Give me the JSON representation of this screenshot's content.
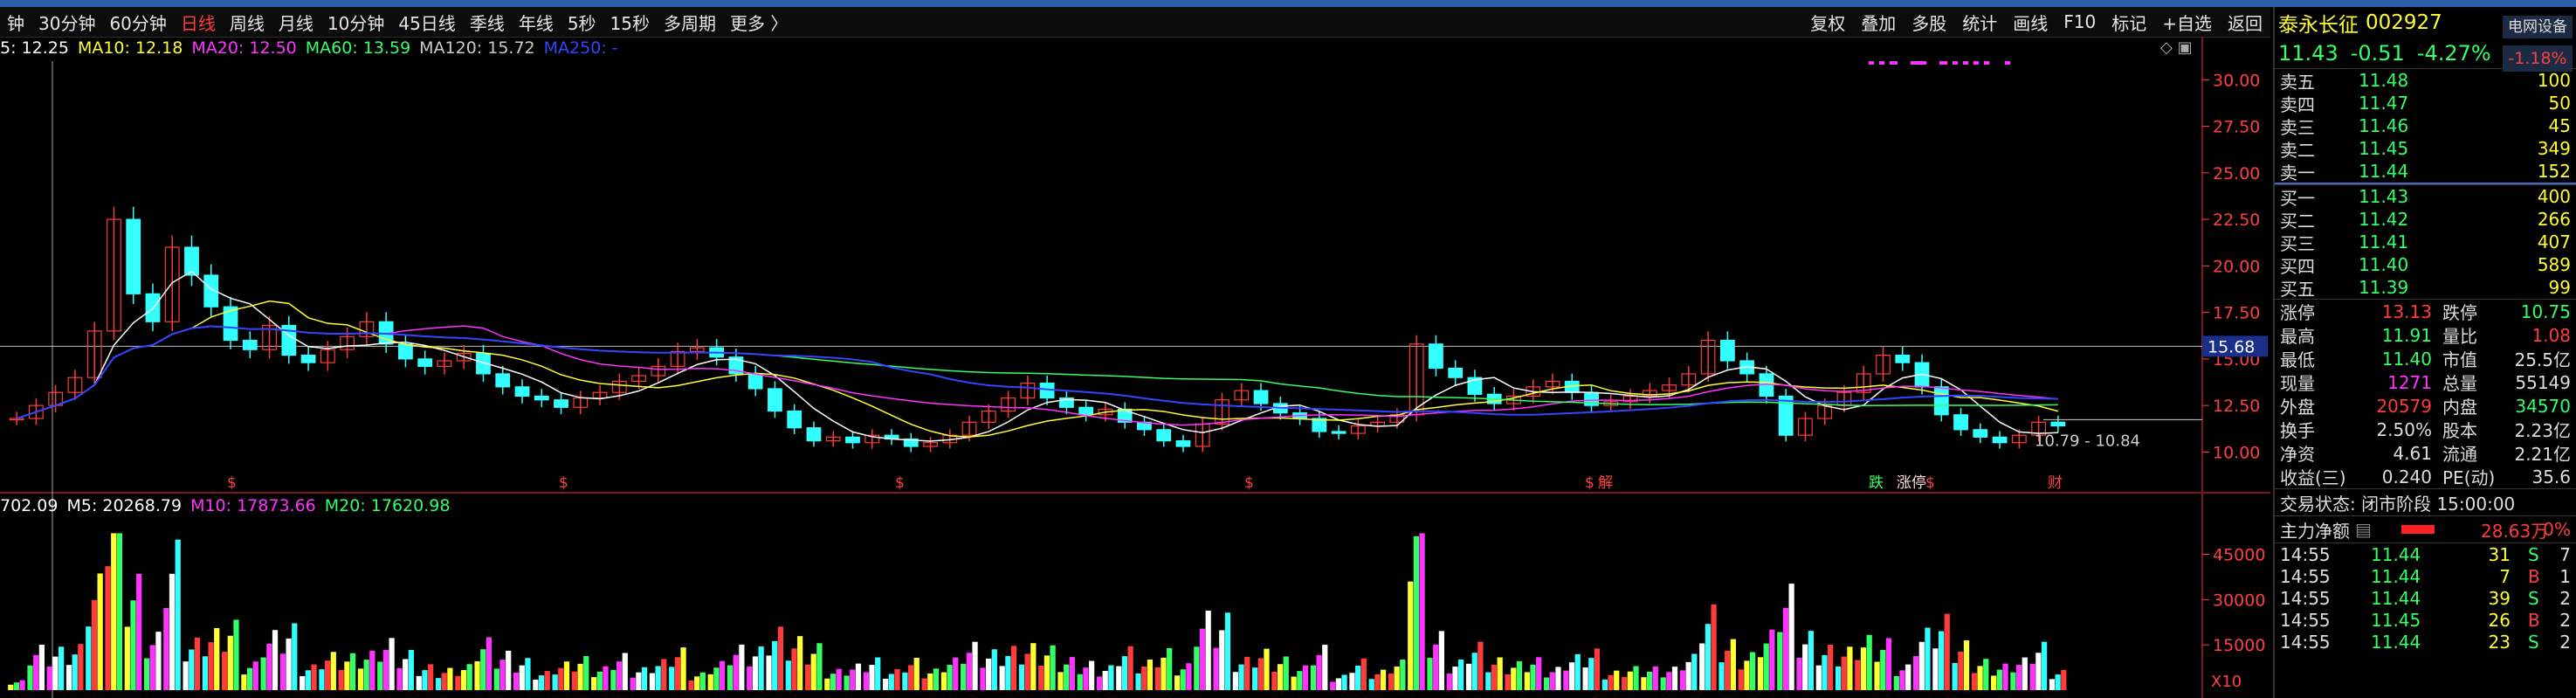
{
  "toolbar": {
    "periods": [
      {
        "label": "钟",
        "active": false
      },
      {
        "label": "30分钟",
        "active": false
      },
      {
        "label": "60分钟",
        "active": false
      },
      {
        "label": "日线",
        "active": true
      },
      {
        "label": "周线",
        "active": false
      },
      {
        "label": "月线",
        "active": false
      },
      {
        "label": "10分钟",
        "active": false
      },
      {
        "label": "45日线",
        "active": false
      },
      {
        "label": "季线",
        "active": false
      },
      {
        "label": "年线",
        "active": false
      },
      {
        "label": "5秒",
        "active": false
      },
      {
        "label": "15秒",
        "active": false
      },
      {
        "label": "多周期",
        "active": false
      },
      {
        "label": "更多 〉",
        "active": false
      }
    ],
    "tools": [
      "复权",
      "叠加",
      "多股",
      "统计",
      "画线",
      "F10",
      "标记",
      "+自选",
      "返回"
    ]
  },
  "ma_legend": [
    {
      "text": "5: 12.25",
      "color": "#ffffff"
    },
    {
      "text": "MA10: 12.18",
      "color": "#ffff33"
    },
    {
      "text": "MA20: 12.50",
      "color": "#ff33ff"
    },
    {
      "text": "MA60: 13.59",
      "color": "#33ff66"
    },
    {
      "text": "MA120: 15.72",
      "color": "#cccccc"
    },
    {
      "text": "MA250: -",
      "color": "#3344ff"
    }
  ],
  "vol_legend": [
    {
      "text": "702.09",
      "color": "#ffffff"
    },
    {
      "text": "M5: 20268.79",
      "color": "#ffffff"
    },
    {
      "text": "M10: 17873.66",
      "color": "#ff33ff"
    },
    {
      "text": "M20: 17620.98",
      "color": "#33ff66"
    }
  ],
  "chart_data": {
    "type": "candlestick",
    "price_axis": {
      "ticks": [
        "30.00",
        "27.50",
        "25.00",
        "22.50",
        "20.00",
        "17.50",
        "15.00",
        "12.50",
        "10.00"
      ],
      "ylim": [
        8,
        31
      ]
    },
    "volume_axis": {
      "ticks": [
        "45000",
        "30000",
        "15000"
      ],
      "unit_label": "X10",
      "ylim": [
        0,
        55000
      ]
    },
    "crosshair_price_label": "15.68",
    "range_annotation": "10.79 - 10.84",
    "event_markers": [
      "$",
      "$",
      "$",
      "$",
      "$",
      "解",
      "跌",
      "涨停",
      "$",
      "财"
    ],
    "close_series": [
      11.8,
      12.5,
      13.2,
      14.0,
      16.5,
      22.5,
      18.5,
      17.0,
      21.0,
      19.5,
      17.8,
      16.0,
      15.5,
      16.8,
      15.2,
      14.8,
      15.5,
      16.2,
      17.0,
      15.8,
      15.0,
      14.6,
      14.9,
      15.3,
      14.2,
      13.5,
      13.0,
      12.8,
      12.4,
      12.9,
      13.2,
      13.8,
      14.1,
      14.6,
      15.4,
      15.6,
      15.1,
      14.2,
      13.4,
      12.2,
      11.3,
      10.6,
      10.8,
      10.5,
      10.9,
      10.7,
      10.3,
      10.5,
      10.9,
      11.6,
      12.2,
      12.9,
      13.7,
      12.9,
      12.4,
      12.0,
      12.3,
      11.6,
      11.2,
      10.6,
      10.3,
      11.5,
      12.8,
      13.3,
      12.6,
      12.1,
      11.8,
      11.1,
      11.0,
      11.4,
      11.6,
      12.0,
      15.8,
      14.5,
      14.0,
      13.1,
      12.6,
      13.0,
      13.5,
      13.8,
      13.2,
      12.5,
      12.7,
      13.0,
      13.3,
      13.6,
      14.2,
      16.0,
      14.9,
      14.2,
      13.0,
      10.9,
      11.8,
      12.5,
      13.2,
      14.2,
      15.2,
      14.8,
      13.5,
      12.0,
      11.2,
      10.8,
      10.5,
      10.9,
      11.6,
      11.4
    ]
  },
  "quote": {
    "name": "泰永长征",
    "code": "002927",
    "btn_device": "电网设备",
    "sector_change": "-1.18%",
    "price": "11.43",
    "change": "-0.51",
    "change_pct": "-4.27%",
    "asks": [
      {
        "label": "卖五",
        "price": "11.48",
        "vol": "100"
      },
      {
        "label": "卖四",
        "price": "11.47",
        "vol": "50"
      },
      {
        "label": "卖三",
        "price": "11.46",
        "vol": "45"
      },
      {
        "label": "卖二",
        "price": "11.45",
        "vol": "349"
      },
      {
        "label": "卖一",
        "price": "11.44",
        "vol": "152"
      }
    ],
    "bids": [
      {
        "label": "买一",
        "price": "11.43",
        "vol": "400"
      },
      {
        "label": "买二",
        "price": "11.42",
        "vol": "266"
      },
      {
        "label": "买三",
        "price": "11.41",
        "vol": "407"
      },
      {
        "label": "买四",
        "price": "11.40",
        "vol": "589"
      },
      {
        "label": "买五",
        "price": "11.39",
        "vol": "99"
      }
    ],
    "stats": [
      {
        "l1": "涨停",
        "v1": "13.13",
        "c1": "red",
        "l2": "跌停",
        "v2": "10.75",
        "c2": "green"
      },
      {
        "l1": "最高",
        "v1": "11.91",
        "c1": "green",
        "l2": "量比",
        "v2": "1.08",
        "c2": "red"
      },
      {
        "l1": "最低",
        "v1": "11.40",
        "c1": "green",
        "l2": "市值",
        "v2": "25.5亿",
        "c2": "white"
      },
      {
        "l1": "现量",
        "v1": "1271",
        "c1": "mag",
        "l2": "总量",
        "v2": "55149",
        "c2": "white"
      },
      {
        "l1": "外盘",
        "v1": "20579",
        "c1": "red",
        "l2": "内盘",
        "v2": "34570",
        "c2": "green"
      },
      {
        "l1": "换手",
        "v1": "2.50%",
        "c1": "white",
        "l2": "股本",
        "v2": "2.23亿",
        "c2": "white"
      },
      {
        "l1": "净资",
        "v1": "4.61",
        "c1": "white",
        "l2": "流通",
        "v2": "2.21亿",
        "c2": "white"
      },
      {
        "l1": "收益(三)",
        "v1": "0.240",
        "c1": "white",
        "l2": "PE(动)",
        "v2": "35.6",
        "c2": "white"
      }
    ],
    "status_label": "交易状态: 闭市阶段 15:00:00",
    "flow_label": "主力净额",
    "flow_value": "28.63万",
    "flow_pct": "0%",
    "ticks": [
      {
        "time": "14:55",
        "price": "11.44",
        "vol": "31",
        "side": "S",
        "n": "7"
      },
      {
        "time": "14:55",
        "price": "11.44",
        "vol": "7",
        "side": "B",
        "n": "1"
      },
      {
        "time": "14:55",
        "price": "11.44",
        "vol": "39",
        "side": "S",
        "n": "2"
      },
      {
        "time": "14:55",
        "price": "11.45",
        "vol": "26",
        "side": "B",
        "n": "2"
      },
      {
        "time": "14:55",
        "price": "11.44",
        "vol": "23",
        "side": "S",
        "n": "2"
      }
    ]
  }
}
